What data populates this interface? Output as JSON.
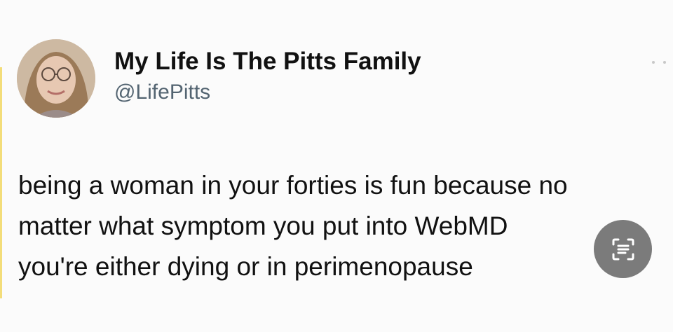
{
  "tweet": {
    "display_name": "My Life Is The Pitts Family",
    "handle": "@LifePitts",
    "text_lines": [
      "being a woman in your forties is fun because no",
      "matter what symptom you put into WebMD",
      "you're either dying or in perimenopause"
    ]
  },
  "icons": {
    "avatar": "profile-photo",
    "more": "more-dots-icon",
    "scan": "text-scan-icon"
  },
  "colors": {
    "background": "#fbfbfb",
    "name": "#111111",
    "handle": "#536471",
    "scan_button": "#646464",
    "accent": "#f3dd7a"
  }
}
